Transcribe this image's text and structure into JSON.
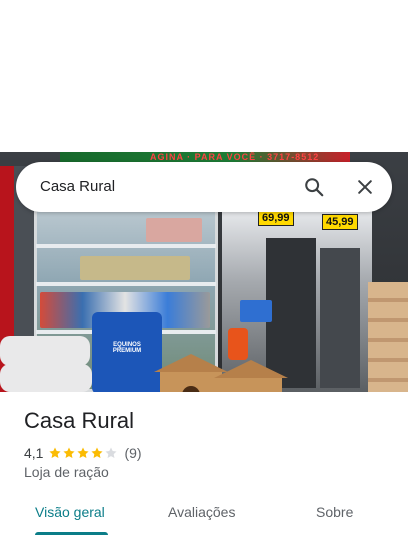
{
  "search": {
    "query": "Casa Rural"
  },
  "photo": {
    "sign_text": "AGINA · PARA VOCÊ · 3717-8512",
    "price_tags": [
      "69,99",
      "45,99"
    ],
    "bag_label": "EQUINOS PREMIUM"
  },
  "place": {
    "name": "Casa Rural",
    "rating": "4,1",
    "stars_filled": 4,
    "stars_total": 5,
    "review_count": "(9)",
    "category": "Loja de ração"
  },
  "tabs": [
    {
      "label": "Visão geral",
      "active": true
    },
    {
      "label": "Avaliações",
      "active": false
    },
    {
      "label": "Sobre",
      "active": false
    }
  ],
  "colors": {
    "accent": "#0b7d88",
    "star": "#fbbc04",
    "star_empty": "#dadce0"
  }
}
